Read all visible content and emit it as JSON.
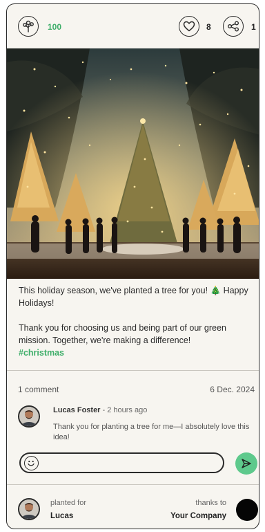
{
  "header": {
    "tree_count": "100",
    "like_count": "8",
    "share_count": "1"
  },
  "photo": {
    "icon": "christmas-trees-photo"
  },
  "post": {
    "line1": "This holiday season, we've planted a tree for you! 🎄 Happy Holidays!",
    "line2": "Thank you for choosing us and being part of our green mission. Together, we're making a difference!",
    "hashtag": "#christmas"
  },
  "meta": {
    "comments": "1 comment",
    "date": "6 Dec. 2024"
  },
  "comment": {
    "author": "Lucas Foster",
    "time": " - 2 hours ago",
    "text": "Thank you for planting a tree for me—I absolutely love this idea!"
  },
  "footer": {
    "planted_label": "planted for",
    "planted_name": "Lucas",
    "thanks_label": "thanks to",
    "thanks_name": "Your Company"
  },
  "colors": {
    "accent": "#3fae6a",
    "send": "#5ec98c",
    "card_bg": "#f7f5f0"
  }
}
